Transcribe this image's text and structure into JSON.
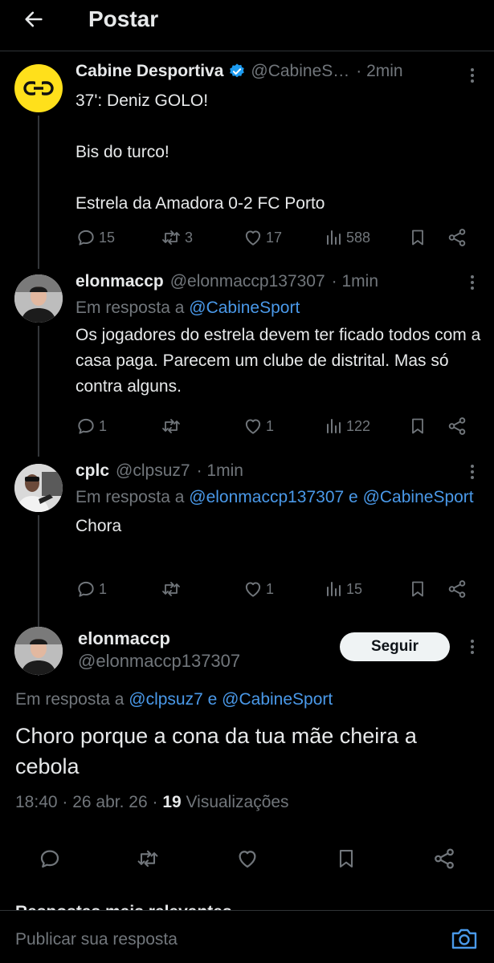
{
  "header": {
    "title": "Postar",
    "back_icon": "arrow-left-icon"
  },
  "tweets": [
    {
      "name": "Cabine Desportiva",
      "verified": true,
      "handle": "@CabineS…",
      "time": "· 2min",
      "reply_prefix": "",
      "reply_to": [],
      "text": "37': Deniz GOLO!\n\nBis do turco!\n\nEstrela da Amadora 0-2 FC Porto",
      "stats": {
        "replies": "15",
        "retweets": "3",
        "likes": "17",
        "views": "588"
      }
    },
    {
      "name": "elonmaccp",
      "verified": false,
      "handle": "@elonmaccp137307",
      "time": "· 1min",
      "reply_prefix": "Em resposta a",
      "reply_to": [
        "@CabineSport"
      ],
      "text": "Os jogadores do estrela devem ter ficado todos com a casa paga. Parecem um clube de distrital. Mas só contra alguns.",
      "stats": {
        "replies": "1",
        "retweets": "",
        "likes": "1",
        "views": "122"
      }
    },
    {
      "name": "cplc",
      "verified": false,
      "handle": "@clpsuz7",
      "time": "· 1min",
      "reply_prefix": "Em resposta a",
      "reply_to": [
        "@elonmaccp137307",
        "@CabineSport"
      ],
      "reply_joiner": "e",
      "text": "Chora",
      "stats": {
        "replies": "1",
        "retweets": "",
        "likes": "1",
        "views": "15"
      }
    }
  ],
  "main_post": {
    "name": "elonmaccp",
    "handle": "@elonmaccp137307",
    "follow_label": "Seguir",
    "reply_prefix": "Em resposta a",
    "reply_to_1": "@clpsuz7",
    "reply_joiner": "e",
    "reply_to_2": "@CabineSport",
    "text": "Choro porque a cona da tua mãe cheira a cebola",
    "time": "18:40",
    "date": "26 abr. 26",
    "views_count": "19",
    "views_label": "Visualizações"
  },
  "partial_section_title": "Respostas mais relevantes",
  "reply_bar": {
    "placeholder": "Publicar sua resposta",
    "camera_icon": "camera-icon"
  },
  "colors": {
    "background": "#000000",
    "link": "#4a99e9",
    "muted": "#71767b",
    "text": "#e7e9ea",
    "verified": "#1d9bf0",
    "cabine_avatar": "#ffe01b"
  }
}
